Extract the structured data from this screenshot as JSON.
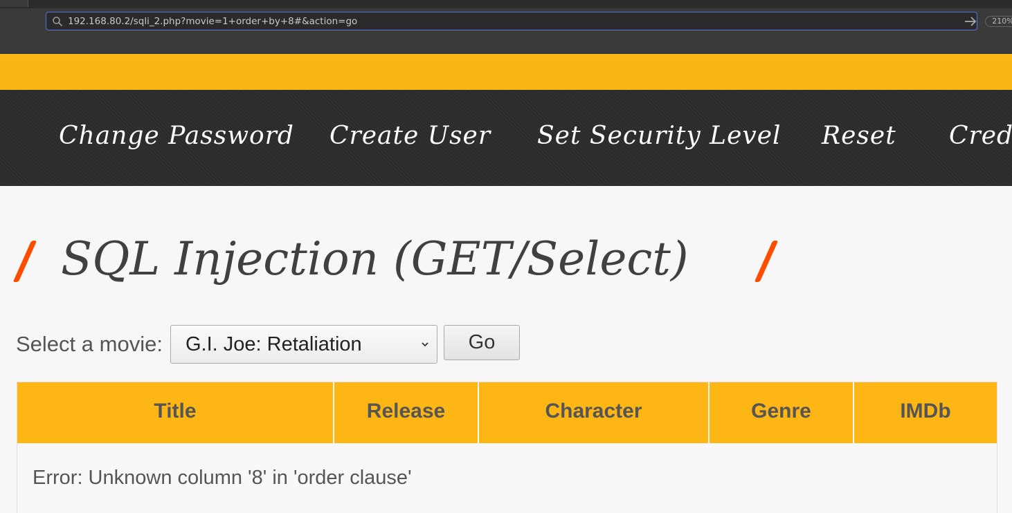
{
  "browser": {
    "url": "192.168.80.2/sqli_2.php?movie=1+order+by+8#&action=go",
    "zoom": "210%"
  },
  "menu": {
    "items": [
      {
        "label": "Change Password"
      },
      {
        "label": "Create User"
      },
      {
        "label": "Set Security Level"
      },
      {
        "label": "Reset"
      },
      {
        "label": "Credi"
      }
    ]
  },
  "page": {
    "title": "SQL Injection (GET/Select)",
    "select_label": "Select a movie:",
    "selected_movie": "G.I. Joe: Retaliation",
    "go_label": "Go"
  },
  "table": {
    "headers": [
      "Title",
      "Release",
      "Character",
      "Genre",
      "IMDb"
    ],
    "error": "Error: Unknown column '8' in 'order clause'"
  },
  "colors": {
    "accent_orange": "#feb614",
    "slash_red": "#ff4d00",
    "menu_dark": "#2c2c2c"
  }
}
